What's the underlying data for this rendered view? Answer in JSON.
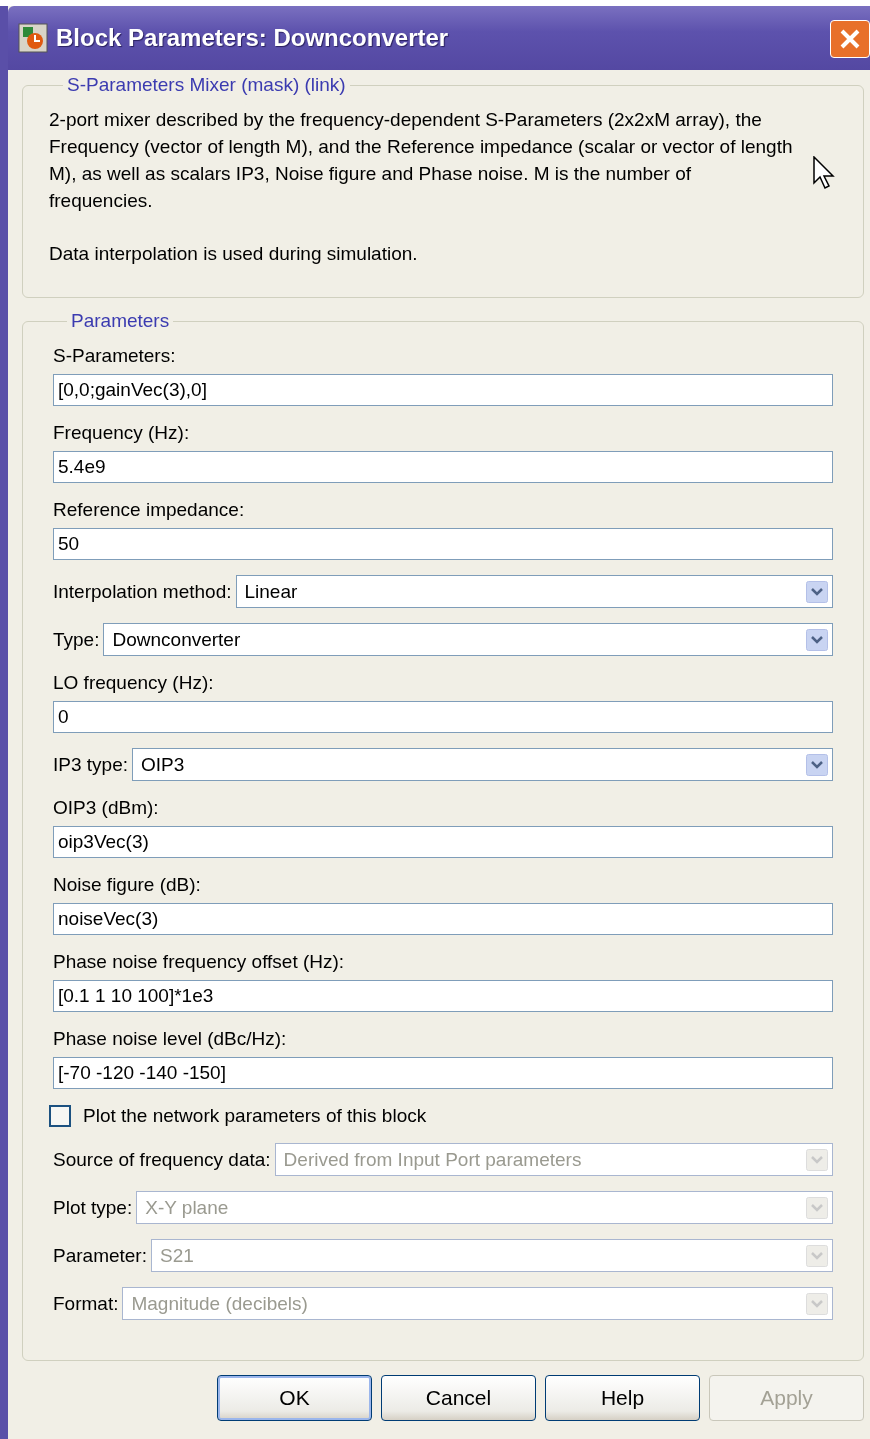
{
  "window": {
    "title": "Block Parameters: Downconverter"
  },
  "description": {
    "title": "S-Parameters Mixer (mask) (link)",
    "paragraphs": [
      "2-port mixer described by the frequency-dependent S-Parameters (2x2xM array), the Frequency (vector of length M), and the Reference impedance (scalar or vector of length M), as well as scalars IP3, Noise figure and Phase noise. M is the number of frequencies.",
      "Data interpolation is used during simulation."
    ]
  },
  "parameters": {
    "title": "Parameters",
    "items": [
      {
        "kind": "text",
        "label": "S-Parameters:",
        "value": "[0,0;gainVec(3),0]"
      },
      {
        "kind": "text",
        "label": "Frequency (Hz):",
        "value": "5.4e9"
      },
      {
        "kind": "text",
        "label": "Reference impedance:",
        "value": "50"
      },
      {
        "kind": "select",
        "label": "Interpolation method:",
        "value": "Linear",
        "disabled": false
      },
      {
        "kind": "select",
        "label": "Type:",
        "value": "Downconverter",
        "disabled": false
      },
      {
        "kind": "text",
        "label": "LO frequency (Hz):",
        "value": "0"
      },
      {
        "kind": "select",
        "label": "IP3 type:",
        "value": "OIP3",
        "disabled": false
      },
      {
        "kind": "text",
        "label": "OIP3 (dBm):",
        "value": "oip3Vec(3)"
      },
      {
        "kind": "text",
        "label": "Noise figure (dB):",
        "value": "noiseVec(3)"
      },
      {
        "kind": "text",
        "label": "Phase noise frequency offset (Hz):",
        "value": "[0.1 1 10 100]*1e3"
      },
      {
        "kind": "text",
        "label": "Phase noise level (dBc/Hz):",
        "value": "[-70 -120 -140 -150]"
      },
      {
        "kind": "checkbox",
        "label": "Plot the network parameters of this block",
        "checked": false
      },
      {
        "kind": "select",
        "label": "Source of frequency data:",
        "value": "Derived from Input Port parameters",
        "disabled": true
      },
      {
        "kind": "select",
        "label": "Plot type:",
        "value": "X-Y plane",
        "disabled": true
      },
      {
        "kind": "select",
        "label": "Parameter:",
        "value": "S21",
        "disabled": true
      },
      {
        "kind": "select",
        "label": "Format:",
        "value": "Magnitude (decibels)",
        "disabled": true
      }
    ]
  },
  "buttons": [
    {
      "label": "OK",
      "default": true,
      "disabled": false
    },
    {
      "label": "Cancel",
      "default": false,
      "disabled": false
    },
    {
      "label": "Help",
      "default": false,
      "disabled": false
    },
    {
      "label": "Apply",
      "default": false,
      "disabled": true
    }
  ]
}
